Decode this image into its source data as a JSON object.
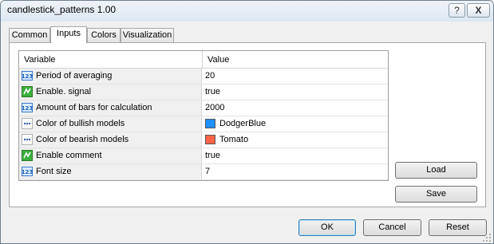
{
  "window": {
    "title": "candlestick_patterns 1.00",
    "help_label": "?",
    "close_label": "X"
  },
  "tabs": [
    {
      "label": "Common"
    },
    {
      "label": "Inputs"
    },
    {
      "label": "Colors"
    },
    {
      "label": "Visualization"
    }
  ],
  "active_tab": "Inputs",
  "grid": {
    "headers": {
      "variable": "Variable",
      "value": "Value"
    },
    "rows": [
      {
        "icon": "numeric-123-icon",
        "name": "Period of averaging",
        "value": "20"
      },
      {
        "icon": "boolean-toggle-icon",
        "name": "Enable. signal",
        "value": "true"
      },
      {
        "icon": "numeric-123-icon",
        "name": "Amount of bars for calculation",
        "value": "2000"
      },
      {
        "icon": "color-dots-icon",
        "name": "Color of bullish models",
        "value": "DodgerBlue",
        "swatch": "#1e90ff"
      },
      {
        "icon": "color-dots-icon",
        "name": "Color of bearish models",
        "value": "Tomato",
        "swatch": "#ff6347"
      },
      {
        "icon": "boolean-toggle-icon",
        "name": "Enable comment",
        "value": "true"
      },
      {
        "icon": "numeric-123-icon",
        "name": "Font size",
        "value": "7"
      }
    ]
  },
  "buttons": {
    "load": "Load",
    "save": "Save",
    "ok": "OK",
    "cancel": "Cancel",
    "reset": "Reset"
  }
}
